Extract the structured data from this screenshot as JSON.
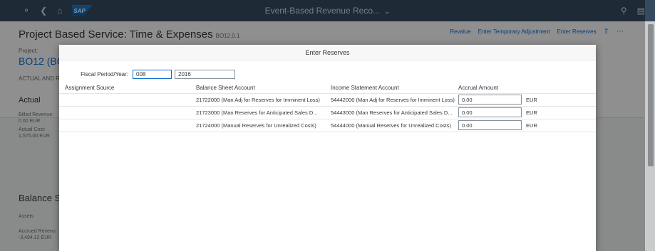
{
  "shell": {
    "title": "Event-Based Revenue Reco...",
    "logo_text": "SAP"
  },
  "object_page": {
    "title": "Project Based Service: Time & Expenses",
    "subtitle": "BO12.0.1",
    "actions": [
      "Revalue",
      "Enter Temporary Adjustment",
      "Enter Reserves"
    ],
    "project_label": "Project:",
    "project_value": "BO12 (BO",
    "section_tab": "ACTUAL AND R",
    "actual": {
      "heading": "Actual",
      "billed_revenue_label": "Billed Revenue:",
      "billed_revenue_value": "0.00 EUR",
      "actual_cost_label": "Actual Cost:",
      "actual_cost_value": "1,575.00 EUR"
    },
    "balance": {
      "heading": "Balance St",
      "assets_label": "Assets",
      "accrued_label": "Accrued Revenu",
      "accrued_value": "-3,494.12 EUR"
    }
  },
  "dialog": {
    "title": "Enter Reserves",
    "fiscal_label": "Fiscal Period/Year:",
    "period_value": "008",
    "year_value": "2016",
    "columns": {
      "source": "Assignment Source",
      "balance": "Balance Sheet Account",
      "income": "Income Statement Account",
      "amount": "Accrual Amount"
    },
    "rows": [
      {
        "source": "",
        "balance": "21722000 (Man Adj for Reserves for Imminent Loss)",
        "income": "54442000 (Man Adj for Reserves for Imminent Loss)",
        "amount": "0.00",
        "currency": "EUR"
      },
      {
        "source": "",
        "balance": "21723000 (Man Reserves for Anticipated Sales D...",
        "income": "54443000 (Man Reserves for Anticipated Sales D...",
        "amount": "0.00",
        "currency": "EUR"
      },
      {
        "source": "",
        "balance": "21724000 (Manual Reserves for Unrealized Costs)",
        "income": "54444000 (Manual Reserves for Unrealized Costs)",
        "amount": "0.00",
        "currency": "EUR"
      }
    ]
  }
}
